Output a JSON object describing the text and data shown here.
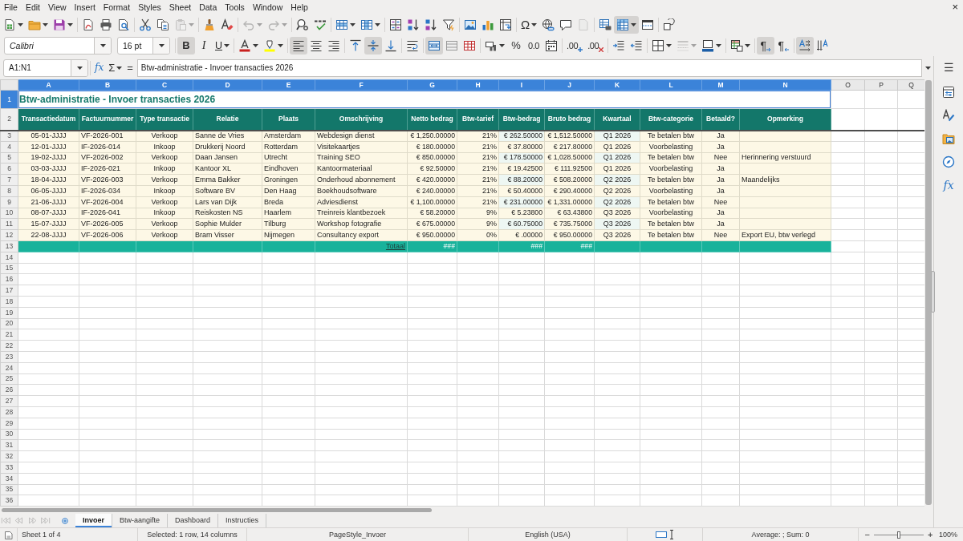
{
  "menu_bar": {
    "items": [
      "File",
      "Edit",
      "View",
      "Insert",
      "Format",
      "Styles",
      "Sheet",
      "Data",
      "Tools",
      "Window",
      "Help"
    ],
    "close": "×"
  },
  "standard_toolbar": [
    [
      {
        "kind": "new",
        "menu": true,
        "pressed": false,
        "disabled": false
      },
      {
        "kind": "open",
        "menu": true,
        "pressed": false,
        "disabled": false
      },
      {
        "kind": "save",
        "menu": true,
        "pressed": false,
        "disabled": false
      }
    ],
    [
      {
        "kind": "pdf",
        "menu": false,
        "pressed": false,
        "disabled": false
      },
      {
        "kind": "print",
        "menu": false,
        "pressed": false,
        "disabled": false
      },
      {
        "kind": "preview",
        "menu": false,
        "pressed": false,
        "disabled": false
      }
    ],
    [
      {
        "kind": "cut",
        "menu": false,
        "pressed": false,
        "disabled": false
      },
      {
        "kind": "copy",
        "menu": false,
        "pressed": false,
        "disabled": false
      },
      {
        "kind": "paste",
        "menu": true,
        "pressed": false,
        "disabled": true
      }
    ],
    [
      {
        "kind": "clone",
        "menu": false,
        "pressed": false,
        "disabled": false
      },
      {
        "kind": "clear",
        "menu": false,
        "pressed": false,
        "disabled": false
      }
    ],
    [
      {
        "kind": "undo",
        "menu": true,
        "pressed": false,
        "disabled": true
      },
      {
        "kind": "redo",
        "menu": true,
        "pressed": false,
        "disabled": true
      }
    ],
    [
      {
        "kind": "find",
        "menu": false,
        "pressed": false,
        "disabled": false
      },
      {
        "kind": "spelling",
        "menu": false,
        "pressed": false,
        "disabled": false
      }
    ],
    [
      {
        "kind": "rows",
        "menu": true,
        "pressed": false,
        "disabled": false
      },
      {
        "kind": "columns",
        "menu": true,
        "pressed": false,
        "disabled": false
      }
    ],
    [
      {
        "kind": "sort",
        "menu": false,
        "pressed": false,
        "disabled": false
      },
      {
        "kind": "sort_ascending",
        "menu": false,
        "pressed": false,
        "disabled": false
      },
      {
        "kind": "sort_descending",
        "menu": false,
        "pressed": false,
        "disabled": false
      },
      {
        "kind": "autofilter",
        "menu": false,
        "pressed": false,
        "disabled": false
      }
    ],
    [
      {
        "kind": "image",
        "menu": false,
        "pressed": false,
        "disabled": false
      },
      {
        "kind": "chart",
        "menu": false,
        "pressed": false,
        "disabled": false
      },
      {
        "kind": "pivot",
        "menu": false,
        "pressed": false,
        "disabled": false
      }
    ],
    [
      {
        "kind": "special",
        "label": "Ω",
        "menu": true,
        "pressed": false,
        "disabled": false
      },
      {
        "kind": "hyperlink",
        "menu": false,
        "pressed": false,
        "disabled": false
      },
      {
        "kind": "comment",
        "menu": false,
        "pressed": false,
        "disabled": false
      },
      {
        "kind": "headers",
        "menu": false,
        "pressed": false,
        "disabled": true
      }
    ],
    [
      {
        "kind": "print_area",
        "menu": false,
        "pressed": false,
        "disabled": false
      },
      {
        "kind": "freeze",
        "menu": true,
        "pressed": true,
        "disabled": false
      },
      {
        "kind": "split",
        "menu": false,
        "pressed": false,
        "disabled": false
      }
    ],
    [
      {
        "kind": "draw",
        "menu": false,
        "pressed": false,
        "disabled": false
      }
    ]
  ],
  "formatting_toolbar": {
    "font_name": "Calibri",
    "font_size": "16 pt",
    "groups": [
      [
        {
          "kind": "bold",
          "label": "B",
          "menu": false,
          "pressed": true,
          "disabled": false
        },
        {
          "kind": "italic",
          "label": "I",
          "menu": false,
          "pressed": false,
          "disabled": false
        },
        {
          "kind": "underline",
          "label": "U",
          "menu": true,
          "pressed": false,
          "disabled": false
        }
      ],
      [
        {
          "kind": "font_color",
          "menu": true,
          "pressed": false,
          "disabled": false
        },
        {
          "kind": "highlight",
          "menu": true,
          "pressed": false,
          "disabled": false
        }
      ],
      [
        {
          "kind": "align_left",
          "menu": false,
          "pressed": true,
          "disabled": false
        },
        {
          "kind": "align_center",
          "menu": false,
          "pressed": false,
          "disabled": false
        },
        {
          "kind": "align_right",
          "menu": false,
          "pressed": false,
          "disabled": false
        }
      ],
      [
        {
          "kind": "align_top",
          "menu": false,
          "pressed": false,
          "disabled": false
        },
        {
          "kind": "align_middle",
          "menu": false,
          "pressed": true,
          "disabled": false
        },
        {
          "kind": "align_bottom",
          "menu": false,
          "pressed": false,
          "disabled": false
        }
      ],
      [
        {
          "kind": "wrap",
          "menu": false,
          "pressed": false,
          "disabled": false
        }
      ],
      [
        {
          "kind": "merge_center",
          "menu": false,
          "pressed": true,
          "disabled": false
        },
        {
          "kind": "merge",
          "menu": false,
          "pressed": false,
          "disabled": false
        },
        {
          "kind": "unmerge",
          "menu": false,
          "pressed": false,
          "disabled": false
        }
      ],
      [
        {
          "kind": "currency",
          "menu": true,
          "pressed": false,
          "disabled": false
        },
        {
          "kind": "percent",
          "label": "%",
          "menu": false,
          "pressed": false,
          "disabled": false
        },
        {
          "kind": "number",
          "label": "0.0",
          "menu": false,
          "pressed": false,
          "disabled": false
        },
        {
          "kind": "date",
          "menu": false,
          "pressed": false,
          "disabled": false
        }
      ],
      [
        {
          "kind": "add_decimal",
          "label": ".00",
          "menu": false,
          "pressed": false,
          "disabled": false
        },
        {
          "kind": "delete_decimal",
          "label": ".00",
          "menu": false,
          "pressed": false,
          "disabled": false
        }
      ],
      [
        {
          "kind": "indent_more",
          "menu": false,
          "pressed": false,
          "disabled": false
        },
        {
          "kind": "indent_less",
          "menu": false,
          "pressed": false,
          "disabled": false
        }
      ],
      [
        {
          "kind": "borders",
          "menu": true,
          "pressed": false,
          "disabled": false
        },
        {
          "kind": "border_style",
          "menu": true,
          "pressed": false,
          "disabled": true
        },
        {
          "kind": "border_color",
          "menu": true,
          "pressed": false,
          "disabled": false
        }
      ],
      [
        {
          "kind": "conditional",
          "menu": true,
          "pressed": false,
          "disabled": false
        }
      ],
      [
        {
          "kind": "ltr",
          "label": "¶",
          "menu": false,
          "pressed": true,
          "disabled": false
        },
        {
          "kind": "rtl",
          "label": "¶",
          "menu": false,
          "pressed": false,
          "disabled": false
        }
      ],
      [
        {
          "kind": "text_direction",
          "menu": false,
          "pressed": true,
          "disabled": false
        },
        {
          "kind": "vertical_text",
          "menu": false,
          "pressed": false,
          "disabled": false
        }
      ]
    ]
  },
  "formula_bar": {
    "name_box": "A1:N1",
    "function_wizard": "fx",
    "sum": "Σ",
    "equals": "=",
    "content": "Btw-administratie - Invoer transacties 2026"
  },
  "sidebar": {
    "menu": "☰",
    "tabs": [
      {
        "kind": "properties",
        "selected": false
      },
      {
        "kind": "styles",
        "selected": false
      },
      {
        "kind": "gallery",
        "selected": false
      },
      {
        "kind": "navigator",
        "selected": false
      },
      {
        "kind": "functions",
        "label": "fx",
        "selected": false
      }
    ]
  },
  "column_headers": [
    {
      "label": "A",
      "selected": true
    },
    {
      "label": "B",
      "selected": true
    },
    {
      "label": "C",
      "selected": true
    },
    {
      "label": "D",
      "selected": true
    },
    {
      "label": "E",
      "selected": true
    },
    {
      "label": "F",
      "selected": true
    },
    {
      "label": "G",
      "selected": true
    },
    {
      "label": "H",
      "selected": true
    },
    {
      "label": "I",
      "selected": true
    },
    {
      "label": "J",
      "selected": true
    },
    {
      "label": "K",
      "selected": true
    },
    {
      "label": "L",
      "selected": true
    },
    {
      "label": "M",
      "selected": true
    },
    {
      "label": "N",
      "selected": true
    },
    {
      "label": "O",
      "selected": false
    },
    {
      "label": "P",
      "selected": false
    },
    {
      "label": "Q",
      "selected": false
    }
  ],
  "row_headers": [
    {
      "label": "1",
      "selected": true
    },
    {
      "label": "2",
      "selected": false
    },
    {
      "label": "3",
      "selected": false
    },
    {
      "label": "4",
      "selected": false
    },
    {
      "label": "5",
      "selected": false
    },
    {
      "label": "6",
      "selected": false
    },
    {
      "label": "7",
      "selected": false
    },
    {
      "label": "8",
      "selected": false
    },
    {
      "label": "9",
      "selected": false
    },
    {
      "label": "10",
      "selected": false
    },
    {
      "label": "11",
      "selected": false
    },
    {
      "label": "12",
      "selected": false
    },
    {
      "label": "13",
      "selected": false
    },
    {
      "label": "14",
      "selected": false
    },
    {
      "label": "15",
      "selected": false
    },
    {
      "label": "16",
      "selected": false
    },
    {
      "label": "17",
      "selected": false
    },
    {
      "label": "18",
      "selected": false
    },
    {
      "label": "19",
      "selected": false
    },
    {
      "label": "20",
      "selected": false
    },
    {
      "label": "21",
      "selected": false
    },
    {
      "label": "22",
      "selected": false
    },
    {
      "label": "23",
      "selected": false
    },
    {
      "label": "24",
      "selected": false
    },
    {
      "label": "25",
      "selected": false
    },
    {
      "label": "26",
      "selected": false
    },
    {
      "label": "27",
      "selected": false
    },
    {
      "label": "28",
      "selected": false
    },
    {
      "label": "29",
      "selected": false
    },
    {
      "label": "30",
      "selected": false
    },
    {
      "label": "31",
      "selected": false
    },
    {
      "label": "32",
      "selected": false
    },
    {
      "label": "33",
      "selected": false
    },
    {
      "label": "34",
      "selected": false
    },
    {
      "label": "35",
      "selected": false
    },
    {
      "label": "36",
      "selected": false
    }
  ],
  "sheet": {
    "title": "Btw-administratie - Invoer transacties 2026",
    "headers": [
      "Transactiedatum",
      "Factuurnummer",
      "Type transactie",
      "Relatie",
      "Plaats",
      "Omschrijving",
      "Netto bedrag",
      "Btw-tarief",
      "Btw-bedrag",
      "Bruto bedrag",
      "Kwartaal",
      "Btw-categorie",
      "Betaald?",
      "Opmerking"
    ],
    "rows": [
      {
        "date": "05-01-JJJJ",
        "invoice": "VF-2026-001",
        "type": "Verkoop",
        "relation": "Sanne de Vries",
        "city": "Amsterdam",
        "description": "Webdesign dienst",
        "net": "€ 1,250.00000",
        "rate": "21%",
        "vat": "€ 262.50000",
        "gross": "€ 1,512.50000",
        "quarter": "Q1 2026",
        "category": "Te betalen btw",
        "paid": "Ja"
      },
      {
        "date": "12-01-JJJJ",
        "invoice": "IF-2026-014",
        "type": "Inkoop",
        "relation": "Drukkerij Noord",
        "city": "Rotterdam",
        "description": "Visitekaartjes",
        "net": "€ 180.00000",
        "rate": "21%",
        "vat": "€ 37.80000",
        "gross": "€ 217.80000",
        "quarter": "Q1 2026",
        "category": "Voorbelasting",
        "paid": "Ja"
      },
      {
        "date": "19-02-JJJJ",
        "invoice": "VF-2026-002",
        "type": "Verkoop",
        "relation": "Daan Jansen",
        "city": "Utrecht",
        "description": "Training SEO",
        "net": "€ 850.00000",
        "rate": "21%",
        "vat": "€ 178.50000",
        "gross": "€ 1,028.50000",
        "quarter": "Q1 2026",
        "category": "Te betalen btw",
        "paid": "Nee",
        "note": "Herinnering verstuurd"
      },
      {
        "date": "03-03-JJJJ",
        "invoice": "IF-2026-021",
        "type": "Inkoop",
        "relation": "Kantoor XL",
        "city": "Eindhoven",
        "description": "Kantoormateriaal",
        "net": "€ 92.50000",
        "rate": "21%",
        "vat": "€ 19.42500",
        "gross": "€ 111.92500",
        "quarter": "Q1 2026",
        "category": "Voorbelasting",
        "paid": "Ja"
      },
      {
        "date": "18-04-JJJJ",
        "invoice": "VF-2026-003",
        "type": "Verkoop",
        "relation": "Emma Bakker",
        "city": "Groningen",
        "description": "Onderhoud abonnement",
        "net": "€ 420.00000",
        "rate": "21%",
        "vat": "€ 88.20000",
        "gross": "€ 508.20000",
        "quarter": "Q2 2026",
        "category": "Te betalen btw",
        "paid": "Ja",
        "note": "Maandelijks"
      },
      {
        "date": "06-05-JJJJ",
        "invoice": "IF-2026-034",
        "type": "Inkoop",
        "relation": "Software BV",
        "city": "Den Haag",
        "description": "Boekhoudsoftware",
        "net": "€ 240.00000",
        "rate": "21%",
        "vat": "€ 50.40000",
        "gross": "€ 290.40000",
        "quarter": "Q2 2026",
        "category": "Voorbelasting",
        "paid": "Ja"
      },
      {
        "date": "21-06-JJJJ",
        "invoice": "VF-2026-004",
        "type": "Verkoop",
        "relation": "Lars van Dijk",
        "city": "Breda",
        "description": "Adviesdienst",
        "net": "€ 1,100.00000",
        "rate": "21%",
        "vat": "€ 231.00000",
        "gross": "€ 1,331.00000",
        "quarter": "Q2 2026",
        "category": "Te betalen btw",
        "paid": "Nee"
      },
      {
        "date": "08-07-JJJJ",
        "invoice": "IF-2026-041",
        "type": "Inkoop",
        "relation": "Reiskosten NS",
        "city": "Haarlem",
        "description": "Treinreis klantbezoek",
        "net": "€ 58.20000",
        "rate": "9%",
        "vat": "€ 5.23800",
        "gross": "€ 63.43800",
        "quarter": "Q3 2026",
        "category": "Voorbelasting",
        "paid": "Ja"
      },
      {
        "date": "15-07-JJJJ",
        "invoice": "VF-2026-005",
        "type": "Verkoop",
        "relation": "Sophie Mulder",
        "city": "Tilburg",
        "description": "Workshop fotografie",
        "net": "€ 675.00000",
        "rate": "9%",
        "vat": "€ 60.75000",
        "gross": "€ 735.75000",
        "quarter": "Q3 2026",
        "category": "Te betalen btw",
        "paid": "Ja"
      },
      {
        "date": "22-08-JJJJ",
        "invoice": "VF-2026-006",
        "type": "Verkoop",
        "relation": "Bram Visser",
        "city": "Nijmegen",
        "description": "Consultancy export",
        "net": "€ 950.00000",
        "rate": "0%",
        "vat": "€ .00000",
        "gross": "€ 950.00000",
        "quarter": "Q3 2026",
        "category": "Te betalen btw",
        "paid": "Nee",
        "note": "Export EU, btw verlegd"
      }
    ],
    "total": {
      "description": "Totaal",
      "net": "###",
      "vat": "###",
      "gross": "###"
    }
  },
  "sheet_navigation": [
    {
      "kind": "first",
      "disabled": true
    },
    {
      "kind": "previous",
      "disabled": true
    },
    {
      "kind": "next",
      "disabled": true
    },
    {
      "kind": "last",
      "disabled": true
    }
  ],
  "sheet_tabs": [
    {
      "label": "Invoer",
      "selected": true
    },
    {
      "label": "Btw-aangifte",
      "selected": false
    },
    {
      "label": "Dashboard",
      "selected": false
    },
    {
      "label": "Instructies",
      "selected": false
    }
  ],
  "status_bar": {
    "sheet": "Sheet 1 of 4",
    "selection": "Selected: 1 row, 14 columns",
    "page_style": "PageStyle_Invoer",
    "language": "English (USA)",
    "statistics": "Average: ; Sum: 0",
    "zoom": {
      "zoom_out": "−",
      "level": 0.5,
      "zoom_in": "+",
      "reading": "100%"
    }
  }
}
